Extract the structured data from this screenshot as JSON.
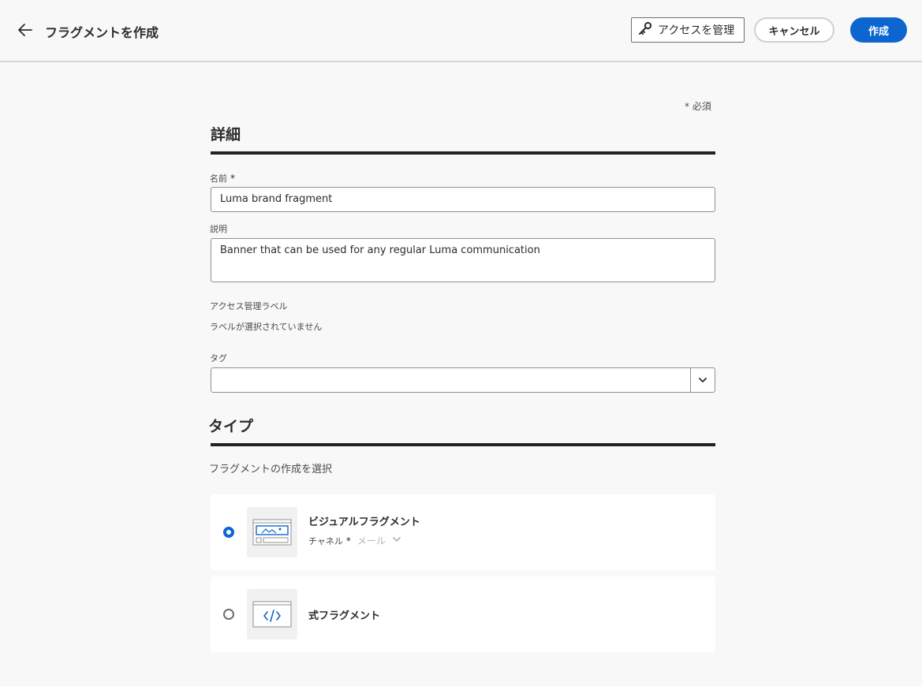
{
  "header": {
    "title": "フラグメントを作成",
    "access_button": "アクセスを管理",
    "cancel_button": "キャンセル",
    "create_button": "作成"
  },
  "form": {
    "required_note": "* 必須",
    "details": {
      "title": "詳細",
      "name_label": "名前",
      "name_required": "*",
      "name_value": "Luma brand fragment",
      "description_label": "説明",
      "description_value": "Banner that can be used for any regular Luma communication",
      "access_label": "アクセス管理ラベル",
      "access_value": "ラベルが選択されていません",
      "tags_label": "タグ",
      "tags_value": ""
    },
    "type": {
      "title": "タイプ",
      "subtitle": "フラグメントの作成を選択",
      "options": [
        {
          "label": "ビジュアルフラグメント",
          "selected": true,
          "icon": "visual-fragment-icon",
          "channel_label": "チャネル",
          "channel_required": "*",
          "channel_value": "メール"
        },
        {
          "label": "式フラグメント",
          "selected": false,
          "icon": "code-fragment-icon"
        }
      ]
    }
  },
  "colors": {
    "accent": "#0d66d0",
    "background": "#f8f8f8",
    "card": "#ffffff",
    "divider": "#222222"
  }
}
